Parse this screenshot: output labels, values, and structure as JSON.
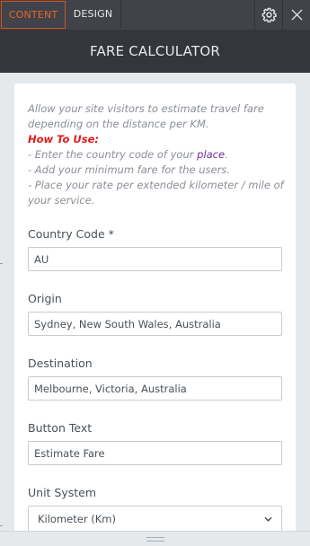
{
  "tabs": {
    "content": "CONTENT",
    "design": "DESIGN"
  },
  "toolbar": {
    "settings_icon": "gear-icon",
    "close_icon": "close-icon"
  },
  "header": {
    "title": "FARE CALCULATOR"
  },
  "description": {
    "intro": "Allow your site visitors to estimate travel fare depending on the distance per KM.",
    "how_to_title": "How To Use:",
    "step1_prefix": "- Enter the country code of your ",
    "step1_link": "place",
    "step1_suffix": ".",
    "step2": "- Add your minimum fare for the users.",
    "step3": "- Place your rate per extended kilometer / mile of your service."
  },
  "fields": {
    "country_code": {
      "label": "Country Code *",
      "value": "AU"
    },
    "origin": {
      "label": "Origin",
      "value": "Sydney, New South Wales, Australia"
    },
    "destination": {
      "label": "Destination",
      "value": "Melbourne, Victoria, Australia"
    },
    "button_text": {
      "label": "Button Text",
      "value": "Estimate Fare"
    },
    "unit_system": {
      "label": "Unit System",
      "value": "Kilometer (Km)"
    }
  },
  "colors": {
    "accent": "#e8642a",
    "howto": "#e01a1a",
    "link": "#6b2d9a",
    "topbar": "#404349",
    "header": "#33363c"
  }
}
